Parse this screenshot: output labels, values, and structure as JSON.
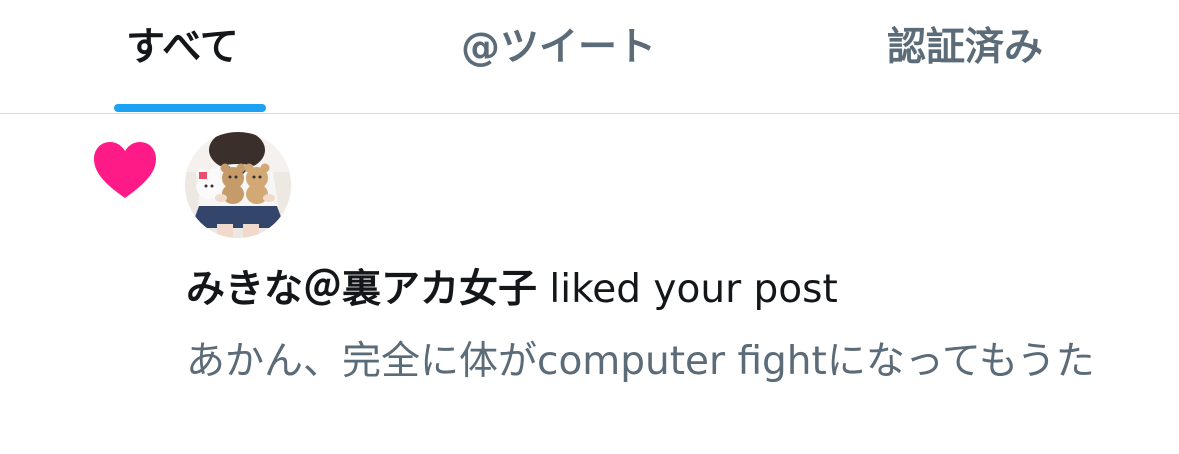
{
  "tabs": [
    {
      "label": "すべて",
      "active": true
    },
    {
      "label": "@ツイート",
      "active": false
    },
    {
      "label": "認証済み",
      "active": false
    }
  ],
  "colors": {
    "accent": "#1da1f2",
    "heart": "#ff1b87",
    "text_primary": "#14171a",
    "text_secondary": "#5b6b78"
  },
  "notification": {
    "type": "like",
    "icon": "heart-icon",
    "user_name": "みきな＠裏アカ女子",
    "action_text": "liked your post",
    "tweet_text": "あかん、完全に体がcomputer fightになってもうた"
  }
}
